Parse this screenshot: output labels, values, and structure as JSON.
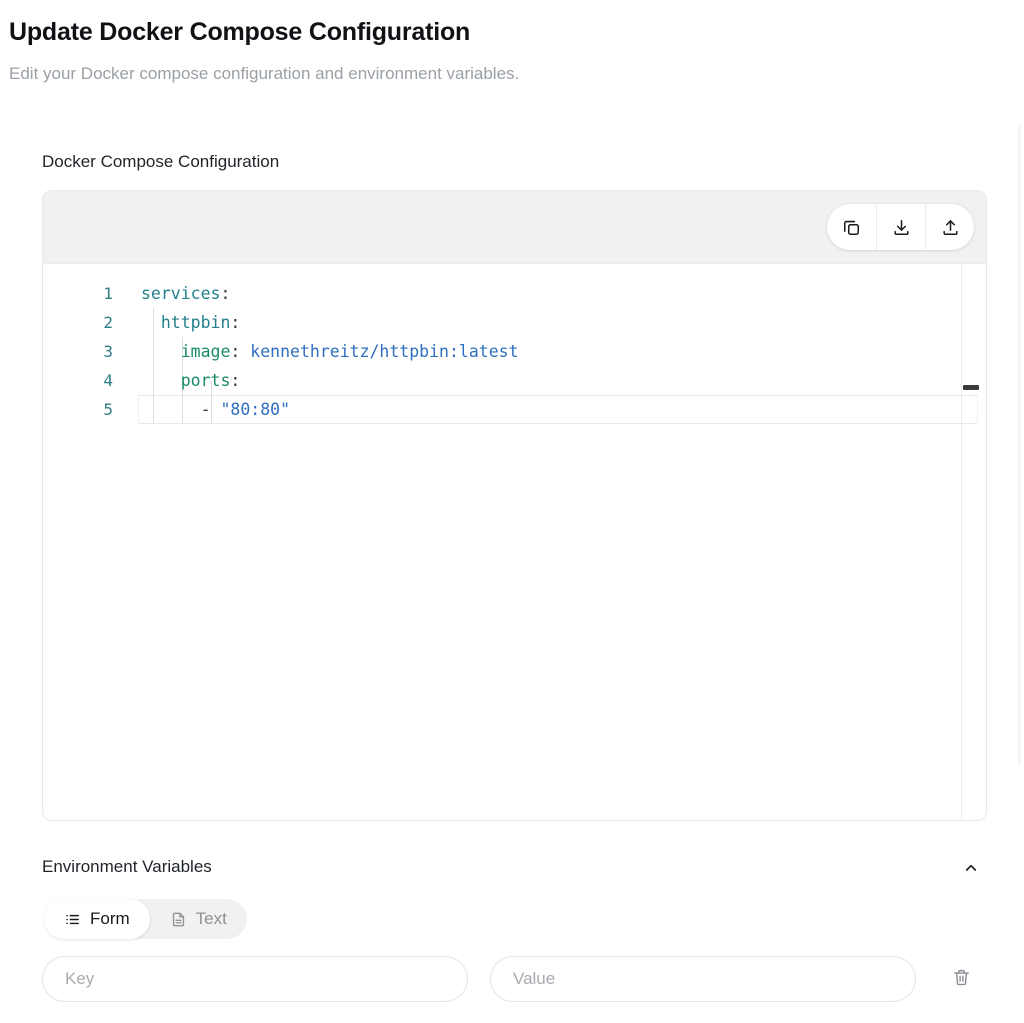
{
  "header": {
    "title": "Update Docker Compose Configuration",
    "subtitle": "Edit your Docker compose configuration and environment variables."
  },
  "editor": {
    "section_label": "Docker Compose Configuration",
    "toolbar": {
      "copy_label": "Copy",
      "download_label": "Download",
      "upload_label": "Upload"
    },
    "language": "yaml",
    "active_line": 5,
    "line_numbers": [
      "1",
      "2",
      "3",
      "4",
      "5"
    ],
    "lines": [
      {
        "number": "1",
        "indent": 0,
        "key": "services",
        "colon": ":",
        "value": ""
      },
      {
        "number": "2",
        "indent": 1,
        "key": "httpbin",
        "colon": ":",
        "value": ""
      },
      {
        "number": "3",
        "indent": 2,
        "key": "image",
        "colon": ":",
        "value": "kennethreitz/httpbin:latest"
      },
      {
        "number": "4",
        "indent": 2,
        "key": "ports",
        "colon": ":",
        "value": ""
      },
      {
        "number": "5",
        "indent": 3,
        "key": "",
        "colon": "",
        "value": "\"80:80\"",
        "dash": "-"
      }
    ],
    "raw_text": "services:\n  httpbin:\n    image: kennethreitz/httpbin:latest\n    ports:\n      - \"80:80\""
  },
  "env_section": {
    "title": "Environment Variables",
    "collapse_icon": "chevron-up-icon",
    "tabs": [
      {
        "label": "Form",
        "icon": "list-icon",
        "active": true
      },
      {
        "label": "Text",
        "icon": "document-icon",
        "active": false
      }
    ],
    "rows": [
      {
        "key_value": "",
        "key_placeholder": "Key",
        "value_value": "",
        "value_placeholder": "Value",
        "delete_icon": "trash-icon"
      }
    ]
  },
  "colors": {
    "title": "#0f1115",
    "subtitle": "#9aa0a6",
    "toolbar_bg": "#f2f1ef",
    "card_border": "#e8e8e6",
    "yaml_key": "#22808d",
    "yaml_key_deep": "#1a8a6a",
    "yaml_value": "#2f6fbf",
    "line_number": "#2f7b85",
    "segment_inactive": "#8e9296"
  }
}
